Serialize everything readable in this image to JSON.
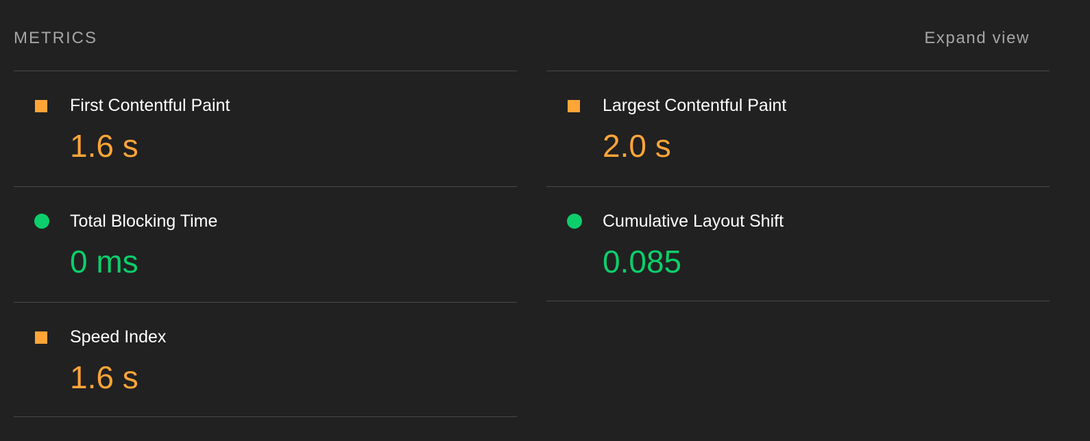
{
  "header": {
    "title": "METRICS",
    "expand_label": "Expand view"
  },
  "colors": {
    "background": "#212121",
    "average": "#ffa538",
    "pass": "#0cce6b",
    "divider": "#4a4a4a"
  },
  "metrics": [
    {
      "label": "First Contentful Paint",
      "value": "1.6 s",
      "status": "average",
      "indicator": "orange-square-icon"
    },
    {
      "label": "Largest Contentful Paint",
      "value": "2.0 s",
      "status": "average",
      "indicator": "orange-square-icon"
    },
    {
      "label": "Total Blocking Time",
      "value": "0 ms",
      "status": "pass",
      "indicator": "green-circle-icon"
    },
    {
      "label": "Cumulative Layout Shift",
      "value": "0.085",
      "status": "pass",
      "indicator": "green-circle-icon"
    },
    {
      "label": "Speed Index",
      "value": "1.6 s",
      "status": "average",
      "indicator": "orange-square-icon"
    }
  ]
}
